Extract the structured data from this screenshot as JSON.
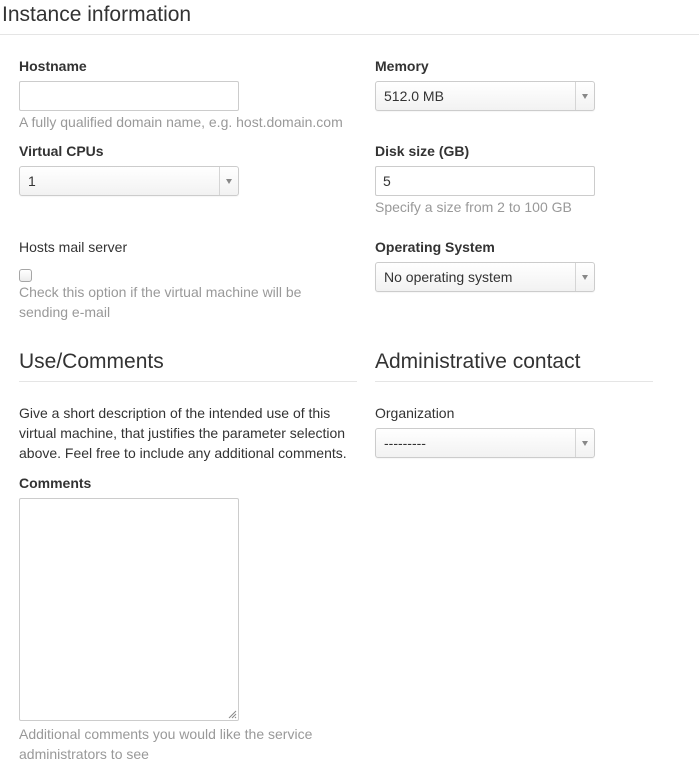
{
  "instance": {
    "title": "Instance information",
    "hostname": {
      "label": "Hostname",
      "value": "",
      "help": "A fully qualified domain name, e.g. host.domain.com"
    },
    "memory": {
      "label": "Memory",
      "value": "512.0 MB"
    },
    "vcpus": {
      "label": "Virtual CPUs",
      "value": "1"
    },
    "disk": {
      "label": "Disk size (GB)",
      "value": "5",
      "help": "Specify a size from 2 to 100 GB"
    },
    "mail": {
      "label": "Hosts mail server",
      "checked": false,
      "help_line1": "Check this option if the virtual machine will be",
      "help_line2": "sending e-mail"
    },
    "os": {
      "label": "Operating System",
      "value": "No operating system"
    }
  },
  "use_comments": {
    "title": "Use/Comments",
    "description_line1": "Give a short description of the intended use of this",
    "description_line2": "virtual machine, that justifies the parameter selection",
    "description_line3": "above. Feel free to include any additional comments.",
    "comments_label": "Comments",
    "comments_value": "",
    "comments_help_line1": "Additional comments you would like the service",
    "comments_help_line2": "administrators to see"
  },
  "admin_contact": {
    "title": "Administrative contact",
    "organization_label": "Organization",
    "organization_value": "---------"
  }
}
